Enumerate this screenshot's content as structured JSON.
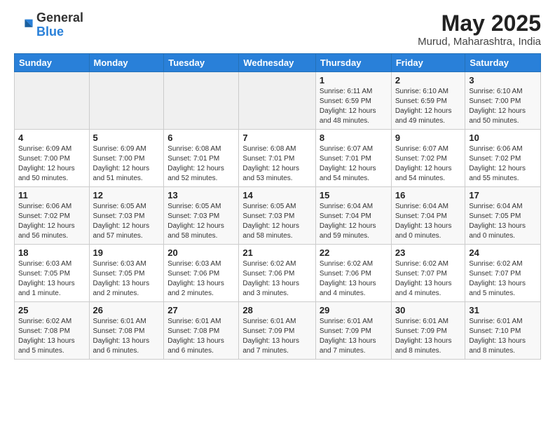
{
  "logo": {
    "general": "General",
    "blue": "Blue"
  },
  "title": "May 2025",
  "subtitle": "Murud, Maharashtra, India",
  "days_of_week": [
    "Sunday",
    "Monday",
    "Tuesday",
    "Wednesday",
    "Thursday",
    "Friday",
    "Saturday"
  ],
  "weeks": [
    [
      {
        "day": "",
        "info": ""
      },
      {
        "day": "",
        "info": ""
      },
      {
        "day": "",
        "info": ""
      },
      {
        "day": "",
        "info": ""
      },
      {
        "day": "1",
        "info": "Sunrise: 6:11 AM\nSunset: 6:59 PM\nDaylight: 12 hours\nand 48 minutes."
      },
      {
        "day": "2",
        "info": "Sunrise: 6:10 AM\nSunset: 6:59 PM\nDaylight: 12 hours\nand 49 minutes."
      },
      {
        "day": "3",
        "info": "Sunrise: 6:10 AM\nSunset: 7:00 PM\nDaylight: 12 hours\nand 50 minutes."
      }
    ],
    [
      {
        "day": "4",
        "info": "Sunrise: 6:09 AM\nSunset: 7:00 PM\nDaylight: 12 hours\nand 50 minutes."
      },
      {
        "day": "5",
        "info": "Sunrise: 6:09 AM\nSunset: 7:00 PM\nDaylight: 12 hours\nand 51 minutes."
      },
      {
        "day": "6",
        "info": "Sunrise: 6:08 AM\nSunset: 7:01 PM\nDaylight: 12 hours\nand 52 minutes."
      },
      {
        "day": "7",
        "info": "Sunrise: 6:08 AM\nSunset: 7:01 PM\nDaylight: 12 hours\nand 53 minutes."
      },
      {
        "day": "8",
        "info": "Sunrise: 6:07 AM\nSunset: 7:01 PM\nDaylight: 12 hours\nand 54 minutes."
      },
      {
        "day": "9",
        "info": "Sunrise: 6:07 AM\nSunset: 7:02 PM\nDaylight: 12 hours\nand 54 minutes."
      },
      {
        "day": "10",
        "info": "Sunrise: 6:06 AM\nSunset: 7:02 PM\nDaylight: 12 hours\nand 55 minutes."
      }
    ],
    [
      {
        "day": "11",
        "info": "Sunrise: 6:06 AM\nSunset: 7:02 PM\nDaylight: 12 hours\nand 56 minutes."
      },
      {
        "day": "12",
        "info": "Sunrise: 6:05 AM\nSunset: 7:03 PM\nDaylight: 12 hours\nand 57 minutes."
      },
      {
        "day": "13",
        "info": "Sunrise: 6:05 AM\nSunset: 7:03 PM\nDaylight: 12 hours\nand 58 minutes."
      },
      {
        "day": "14",
        "info": "Sunrise: 6:05 AM\nSunset: 7:03 PM\nDaylight: 12 hours\nand 58 minutes."
      },
      {
        "day": "15",
        "info": "Sunrise: 6:04 AM\nSunset: 7:04 PM\nDaylight: 12 hours\nand 59 minutes."
      },
      {
        "day": "16",
        "info": "Sunrise: 6:04 AM\nSunset: 7:04 PM\nDaylight: 13 hours\nand 0 minutes."
      },
      {
        "day": "17",
        "info": "Sunrise: 6:04 AM\nSunset: 7:05 PM\nDaylight: 13 hours\nand 0 minutes."
      }
    ],
    [
      {
        "day": "18",
        "info": "Sunrise: 6:03 AM\nSunset: 7:05 PM\nDaylight: 13 hours\nand 1 minute."
      },
      {
        "day": "19",
        "info": "Sunrise: 6:03 AM\nSunset: 7:05 PM\nDaylight: 13 hours\nand 2 minutes."
      },
      {
        "day": "20",
        "info": "Sunrise: 6:03 AM\nSunset: 7:06 PM\nDaylight: 13 hours\nand 2 minutes."
      },
      {
        "day": "21",
        "info": "Sunrise: 6:02 AM\nSunset: 7:06 PM\nDaylight: 13 hours\nand 3 minutes."
      },
      {
        "day": "22",
        "info": "Sunrise: 6:02 AM\nSunset: 7:06 PM\nDaylight: 13 hours\nand 4 minutes."
      },
      {
        "day": "23",
        "info": "Sunrise: 6:02 AM\nSunset: 7:07 PM\nDaylight: 13 hours\nand 4 minutes."
      },
      {
        "day": "24",
        "info": "Sunrise: 6:02 AM\nSunset: 7:07 PM\nDaylight: 13 hours\nand 5 minutes."
      }
    ],
    [
      {
        "day": "25",
        "info": "Sunrise: 6:02 AM\nSunset: 7:08 PM\nDaylight: 13 hours\nand 5 minutes."
      },
      {
        "day": "26",
        "info": "Sunrise: 6:01 AM\nSunset: 7:08 PM\nDaylight: 13 hours\nand 6 minutes."
      },
      {
        "day": "27",
        "info": "Sunrise: 6:01 AM\nSunset: 7:08 PM\nDaylight: 13 hours\nand 6 minutes."
      },
      {
        "day": "28",
        "info": "Sunrise: 6:01 AM\nSunset: 7:09 PM\nDaylight: 13 hours\nand 7 minutes."
      },
      {
        "day": "29",
        "info": "Sunrise: 6:01 AM\nSunset: 7:09 PM\nDaylight: 13 hours\nand 7 minutes."
      },
      {
        "day": "30",
        "info": "Sunrise: 6:01 AM\nSunset: 7:09 PM\nDaylight: 13 hours\nand 8 minutes."
      },
      {
        "day": "31",
        "info": "Sunrise: 6:01 AM\nSunset: 7:10 PM\nDaylight: 13 hours\nand 8 minutes."
      }
    ]
  ]
}
